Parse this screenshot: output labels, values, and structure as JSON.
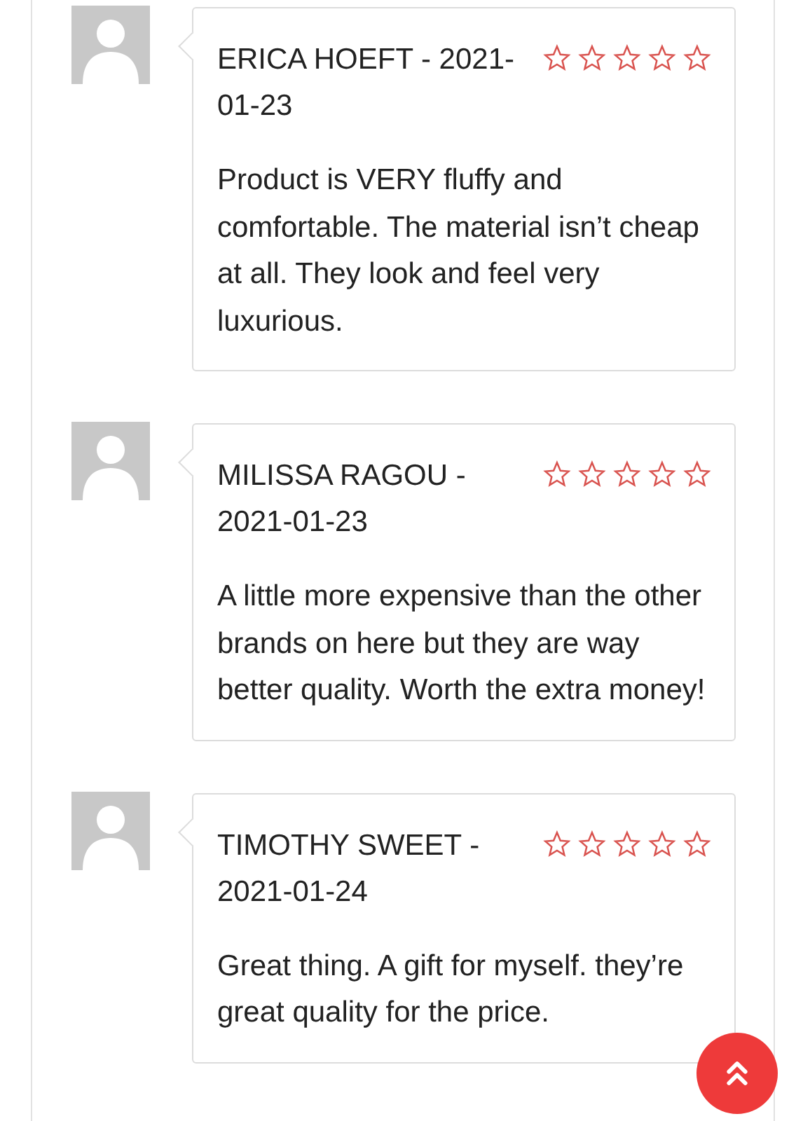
{
  "reviews": [
    {
      "heading": "ERICA HOEFT - 2021-01-23",
      "stars": 0,
      "text": "Product is VERY fluffy and comfortable. The material isn’t cheap at all. They look and feel very luxurious."
    },
    {
      "heading": "MILISSA RAGOU - 2021-01-23",
      "stars": 0,
      "text": "A little more expensive than the other brands on here but they are way better quality. Worth the extra money!"
    },
    {
      "heading": "TIMOTHY SWEET - 2021-01-24",
      "stars": 0,
      "text": "Great thing. A gift for myself. they’re great quality for the price."
    }
  ]
}
